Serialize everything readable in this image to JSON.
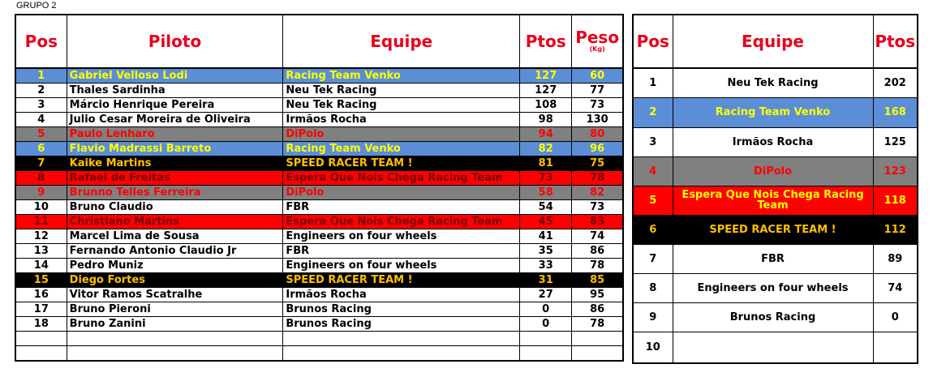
{
  "group_label": "GRUPO 2",
  "drivers_table": {
    "headers": {
      "pos": "Pos",
      "piloto": "Piloto",
      "equipe": "Equipe",
      "ptos": "Ptos",
      "peso": "Peso",
      "peso_unit": "(Kg)"
    },
    "rows": [
      {
        "pos": "1",
        "piloto": "Gabriel Velloso Lodi",
        "equipe": "Racing Team Venko",
        "ptos": "127",
        "peso": "60",
        "style": "blue"
      },
      {
        "pos": "2",
        "piloto": "Thales Sardinha",
        "equipe": "Neu Tek Racing",
        "ptos": "127",
        "peso": "77",
        "style": "white"
      },
      {
        "pos": "3",
        "piloto": "Márcio Henrique Pereira",
        "equipe": "Neu Tek Racing",
        "ptos": "108",
        "peso": "73",
        "style": "white"
      },
      {
        "pos": "4",
        "piloto": "Julio Cesar Moreira de Oliveira",
        "equipe": "Irmãos Rocha",
        "ptos": "98",
        "peso": "130",
        "style": "white"
      },
      {
        "pos": "5",
        "piloto": "Paulo Lenharo",
        "equipe": "DiPolo",
        "ptos": "94",
        "peso": "80",
        "style": "gray"
      },
      {
        "pos": "6",
        "piloto": "Flavio Madrassi Barreto",
        "equipe": "Racing Team Venko",
        "ptos": "82",
        "peso": "96",
        "style": "blue"
      },
      {
        "pos": "7",
        "piloto": "Kaike Martins",
        "equipe": "SPEED RACER TEAM !",
        "ptos": "81",
        "peso": "75",
        "style": "black"
      },
      {
        "pos": "8",
        "piloto": "Rafael de Freitas",
        "equipe": "Espera Que Nois Chega Racing Team",
        "ptos": "73",
        "peso": "78",
        "style": "red"
      },
      {
        "pos": "9",
        "piloto": "Brunno Telles Ferreira",
        "equipe": "DiPolo",
        "ptos": "58",
        "peso": "82",
        "style": "gray"
      },
      {
        "pos": "10",
        "piloto": "Bruno Claudio",
        "equipe": "FBR",
        "ptos": "54",
        "peso": "73",
        "style": "white"
      },
      {
        "pos": "11",
        "piloto": "Christiano Martins",
        "equipe": "Espera Que Nois Chega Racing Team",
        "ptos": "45",
        "peso": "83",
        "style": "red"
      },
      {
        "pos": "12",
        "piloto": "Marcel Lima de Sousa",
        "equipe": "Engineers on four wheels",
        "ptos": "41",
        "peso": "74",
        "style": "white"
      },
      {
        "pos": "13",
        "piloto": "Fernando Antonio Claudio Jr",
        "equipe": "FBR",
        "ptos": "35",
        "peso": "86",
        "style": "white"
      },
      {
        "pos": "14",
        "piloto": "Pedro Muniz",
        "equipe": "Engineers on four wheels",
        "ptos": "33",
        "peso": "78",
        "style": "white"
      },
      {
        "pos": "15",
        "piloto": "Diego Fortes",
        "equipe": "SPEED RACER TEAM !",
        "ptos": "31",
        "peso": "85",
        "style": "black"
      },
      {
        "pos": "16",
        "piloto": "Vitor Ramos Scatralhe",
        "equipe": "Irmãos Rocha",
        "ptos": "27",
        "peso": "95",
        "style": "white"
      },
      {
        "pos": "17",
        "piloto": "Bruno Pieroni",
        "equipe": "Brunos Racing",
        "ptos": "0",
        "peso": "86",
        "style": "white"
      },
      {
        "pos": "18",
        "piloto": "Bruno Zanini",
        "equipe": "Brunos Racing",
        "ptos": "0",
        "peso": "78",
        "style": "white"
      },
      {
        "pos": "",
        "piloto": "",
        "equipe": "",
        "ptos": "",
        "peso": "",
        "style": "white"
      },
      {
        "pos": "",
        "piloto": "",
        "equipe": "",
        "ptos": "",
        "peso": "",
        "style": "white"
      }
    ]
  },
  "teams_table": {
    "headers": {
      "pos": "Pos",
      "equipe": "Equipe",
      "ptos": "Ptos"
    },
    "rows": [
      {
        "pos": "1",
        "equipe": "Neu Tek Racing",
        "ptos": "202",
        "style": "white"
      },
      {
        "pos": "2",
        "equipe": "Racing Team Venko",
        "ptos": "168",
        "style": "blue"
      },
      {
        "pos": "3",
        "equipe": "Irmãos Rocha",
        "ptos": "125",
        "style": "white"
      },
      {
        "pos": "4",
        "equipe": "DiPolo",
        "ptos": "123",
        "style": "gray"
      },
      {
        "pos": "5",
        "equipe": "Espera Que Nois Chega Racing Team",
        "ptos": "118",
        "style": "red"
      },
      {
        "pos": "6",
        "equipe": "SPEED RACER TEAM !",
        "ptos": "112",
        "style": "black"
      },
      {
        "pos": "7",
        "equipe": "FBR",
        "ptos": "89",
        "style": "white"
      },
      {
        "pos": "8",
        "equipe": "Engineers on four wheels",
        "ptos": "74",
        "style": "white"
      },
      {
        "pos": "9",
        "equipe": "Brunos Racing",
        "ptos": "0",
        "style": "white"
      },
      {
        "pos": "10",
        "equipe": "",
        "ptos": "",
        "style": "white"
      }
    ]
  },
  "colors": {
    "header_text": "#e8001c",
    "blue_row": "#5b8ed6",
    "gray_row": "#808080",
    "black_row": "#000000",
    "red_row": "#ff0000"
  }
}
